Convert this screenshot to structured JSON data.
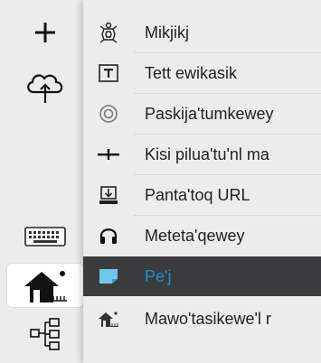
{
  "sidebar": {
    "buttons": [
      {
        "icon": "plus-icon"
      },
      {
        "icon": "cloud-upload-icon"
      },
      {
        "icon": "keyboard-icon"
      },
      {
        "icon": "home-icon"
      },
      {
        "icon": "sitemap-icon"
      }
    ],
    "active_index": 3
  },
  "menu": {
    "items": [
      {
        "label": "Mikjikj",
        "icon": "turtle-icon"
      },
      {
        "label": "Tett ewikasik",
        "icon": "text-box-icon"
      },
      {
        "label": "Paskija'tumkewey",
        "icon": "target-icon"
      },
      {
        "label": "Kisi pilua'tu'nl ma",
        "icon": "ruler-icon"
      },
      {
        "label": "Panta'toq URL",
        "icon": "download-icon"
      },
      {
        "label": "Meteta'qewey",
        "icon": "headphones-icon"
      },
      {
        "label": "Pe'j",
        "icon": "note-icon",
        "selected": true
      },
      {
        "label": "Mawo'tasikewe'l r",
        "icon": "home-small-icon"
      }
    ],
    "selected_color": "#1993d8"
  }
}
